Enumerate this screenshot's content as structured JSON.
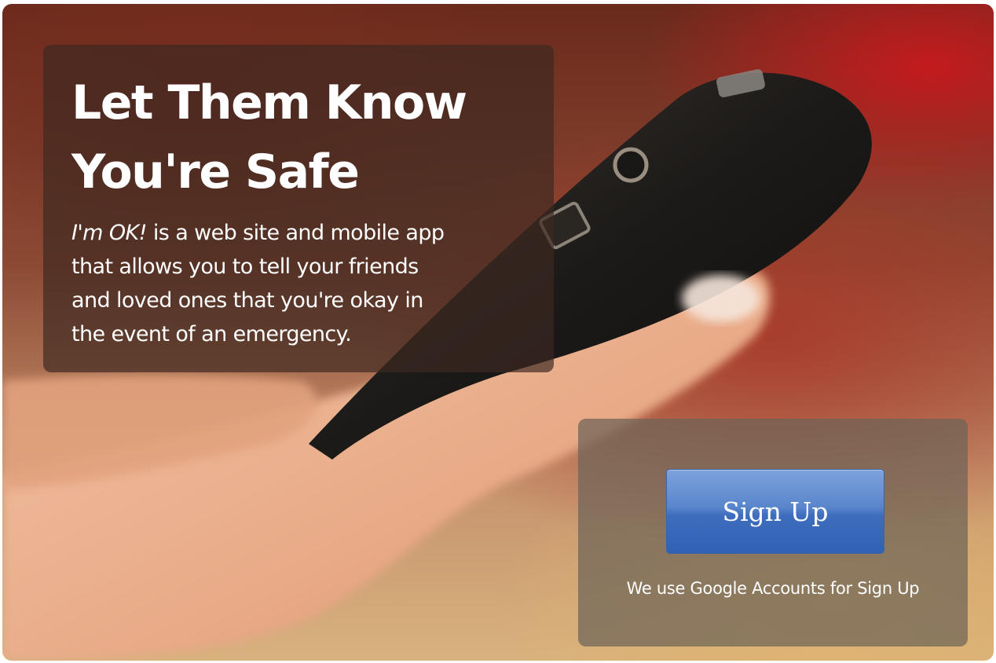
{
  "hero": {
    "headline": [
      "Let Them Know",
      "You're Safe"
    ],
    "description": {
      "app_name": "I'm OK!",
      "lines": [
        " is a web site and mobile app",
        "that allows you to tell your friends",
        "and loved ones that you're okay in",
        "the event of an emergency."
      ]
    },
    "photo_alt": "hand-holding-phone-photo"
  },
  "signup": {
    "button_label": "Sign Up",
    "note": "We use Google Accounts for Sign Up"
  },
  "colors": {
    "button_blue": "#3e6dbd",
    "panel_dark": "#3c2820",
    "panel_gray": "#6e6458"
  }
}
